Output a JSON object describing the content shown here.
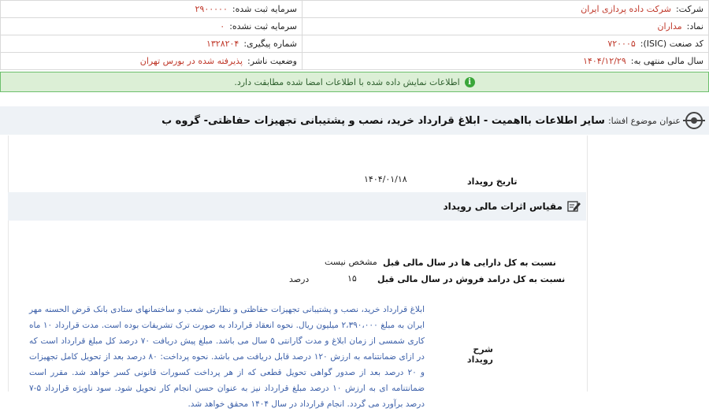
{
  "info": {
    "company_label": "شرکت:",
    "company_value": "شرکت داده پردازی ایران",
    "reg_capital_label": "سرمایه ثبت شده:",
    "reg_capital_value": "۲۹۰۰۰۰۰",
    "symbol_label": "نماد:",
    "symbol_value": "مداران",
    "unreg_capital_label": "سرمایه ثبت نشده:",
    "unreg_capital_value": "۰",
    "isic_label": "کد صنعت (ISIC):",
    "isic_value": "۷۲۰۰۰۵",
    "tracking_label": "شماره پیگیری:",
    "tracking_value": "۱۳۲۸۲۰۴",
    "fiscal_label": "سال مالی منتهی به:",
    "fiscal_value": "۱۴۰۴/۱۲/۲۹",
    "publisher_label": "وضعیت ناشر:",
    "publisher_value": "پذیرفته شده در بورس تهران"
  },
  "notice": {
    "icon": "info-icon",
    "text": "اطلاعات نمایش داده شده با اطلاعات امضا شده مطابقت دارد."
  },
  "subject": {
    "label": "عنوان موضوع افشا:",
    "text": "سایر اطلاعات بااهمیت - ابلاغ قرارداد خرید، نصب و پشتیبانی تجهیزات حفاظتی- گروه ب"
  },
  "event": {
    "date_label": "تاریخ رویداد",
    "date_value": "۱۴۰۴/۰۱/۱۸"
  },
  "section": {
    "title": "مقیاس اثرات مالی رویداد"
  },
  "ratios": {
    "assets_label": "نسبت به کل دارایی ها در سال مالی قبل",
    "assets_value": "مشخص نیست",
    "revenue_label": "نسبت به کل درامد فروش در سال مالی قبل",
    "revenue_value": "۱۵",
    "revenue_unit": "درصد"
  },
  "description": {
    "label": "شرح رویداد",
    "text": "ابلاغ قرارداد خرید، نصب و پشتیبانی تجهیزات حفاظتی و نظارتی شعب و ساختمانهای ستادی بانک قرض الحسنه مهر ایران به مبلغ ۲،۳۹۰،۰۰۰ میلیون ریال. نحوه انعقاد قرارداد به صورت ترک تشریفات بوده است. مدت قرارداد ۱۰ ماه کاری شمسی از زمان ابلاغ و مدت گارانتی ۵ سال می باشد. مبلغ پیش دریافت ۷۰ درصد کل مبلغ قرارداد است که در ازای ضمانتنامه به ارزش ۱۲۰ درصد قابل دریافت می باشد. نحوه پرداخت: ۸۰ درصد بعد از تحویل کامل تجهیزات و ۲۰ درصد بعد از صدور گواهی تحویل قطعی که از هر پرداخت کسورات قانونی کسر خواهد شد. مقرر است ضمانتنامه ای به ارزش ۱۰ درصد مبلغ قرارداد نیز به عنوان حسن انجام کار تحویل شود. سود ناویژه قرارداد ۵-۷ درصد برآورد می گردد. انجام قرارداد در سال ۱۴۰۴ محقق خواهد شد."
  }
}
